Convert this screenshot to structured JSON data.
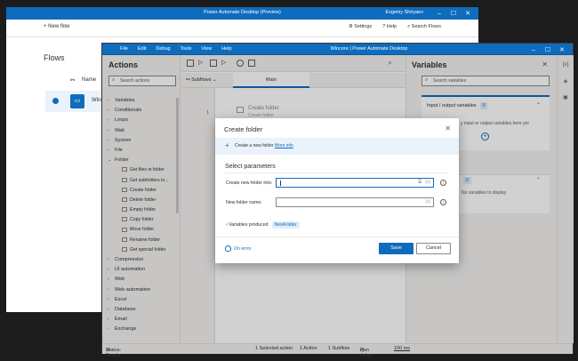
{
  "console": {
    "title": "Power Automate Desktop (Preview)",
    "user": "Evgeniy Shiryaev",
    "toolbar": {
      "new_flow": "New flow",
      "settings": "Settings",
      "help": "Help",
      "search": "Search Flows"
    },
    "flows_title": "Flows",
    "column_name": "Name",
    "flow_name": "Winco"
  },
  "designer": {
    "menu": [
      "File",
      "Edit",
      "Debug",
      "Tools",
      "View",
      "Help"
    ],
    "title": "Wincore | Power Automate Desktop",
    "actions": {
      "header": "Actions",
      "search_placeholder": "Search actions",
      "items": [
        {
          "label": "Variables",
          "level": 0,
          "caret": "›"
        },
        {
          "label": "Conditionals",
          "level": 0,
          "caret": "›"
        },
        {
          "label": "Loops",
          "level": 0,
          "caret": "›"
        },
        {
          "label": "Wait",
          "level": 0,
          "caret": "›"
        },
        {
          "label": "System",
          "level": 0,
          "caret": "›"
        },
        {
          "label": "File",
          "level": 0,
          "caret": "›"
        },
        {
          "label": "Folder",
          "level": 0,
          "caret": "⌄"
        },
        {
          "label": "Get files in folder",
          "level": 1
        },
        {
          "label": "Get subfolders in...",
          "level": 1
        },
        {
          "label": "Create folder",
          "level": 1
        },
        {
          "label": "Delete folder",
          "level": 1
        },
        {
          "label": "Empty folder",
          "level": 1
        },
        {
          "label": "Copy folder",
          "level": 1
        },
        {
          "label": "Move folder",
          "level": 1
        },
        {
          "label": "Rename folder",
          "level": 1
        },
        {
          "label": "Get special folder",
          "level": 1
        },
        {
          "label": "Compression",
          "level": 0,
          "caret": "›"
        },
        {
          "label": "UI automation",
          "level": 0,
          "caret": "›"
        },
        {
          "label": "Web",
          "level": 0,
          "caret": "›"
        },
        {
          "label": "Web automation",
          "level": 0,
          "caret": "›"
        },
        {
          "label": "Excel",
          "level": 0,
          "caret": "›"
        },
        {
          "label": "Database",
          "level": 0,
          "caret": "›"
        },
        {
          "label": "Email",
          "level": 0,
          "caret": "›"
        },
        {
          "label": "Exchange",
          "level": 0,
          "caret": "›"
        }
      ]
    },
    "main": {
      "subflows_label": "Subflows",
      "tab_main": "Main",
      "line_number": "1",
      "step_title": "Create folder",
      "step_subtitle": "Create folder"
    },
    "variables": {
      "header": "Variables",
      "search_placeholder": "Search variables",
      "io_label": "Input / output variables",
      "io_count": "0",
      "io_empty": "y input or output variables here yet",
      "flow_count": "0",
      "flow_empty": "No variables to display"
    },
    "status": {
      "ready": "Status: Ready",
      "selected": "1 Selected action",
      "actions": "1 Action",
      "subflow": "1 Subflow",
      "run_delay_label": "Run delay",
      "run_delay_value": "100 ms"
    }
  },
  "dialog": {
    "title": "Create folder",
    "info_text": "Create a new folder",
    "info_link": "More info",
    "section": "Select parameters",
    "field1_label": "Create new folder into:",
    "field2_label": "New folder name:",
    "fx": "{x}",
    "vars_produced": "Variables produced",
    "vars_chip": "NewFolder",
    "on_error": "On error",
    "save": "Save",
    "cancel": "Cancel"
  }
}
